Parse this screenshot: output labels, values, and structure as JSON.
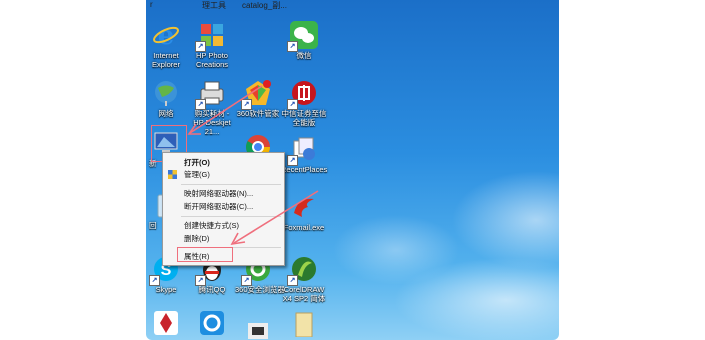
{
  "desktop": {
    "top_labels": [
      "r",
      "理工具",
      "catalog_副..."
    ],
    "icons": [
      {
        "label": "Internet Explorer",
        "icon": "internet-explorer-icon"
      },
      {
        "label": "HP Photo Creations",
        "icon": "hp-photo-icon"
      },
      {
        "label": "微信",
        "icon": "wechat-icon"
      },
      {
        "label": "网络",
        "icon": "network-icon"
      },
      {
        "label": "购买耗材 - HP Deskjet 21...",
        "icon": "printer-icon"
      },
      {
        "label": "360软件管家",
        "icon": "360-software-icon"
      },
      {
        "label": "中信证券至信全能版",
        "icon": "citic-icon"
      },
      {
        "label": "RecentPlaces",
        "icon": "recent-places-icon"
      },
      {
        "label": "Foxmail.exe",
        "icon": "foxmail-icon"
      },
      {
        "label": "Skype",
        "icon": "skype-icon"
      },
      {
        "label": "腾讯QQ",
        "icon": "qq-icon"
      },
      {
        "label": "360安全浏览器",
        "icon": "360-browser-icon"
      },
      {
        "label": "CorelDRAW X4 SP2 简体",
        "icon": "coreldraw-icon"
      }
    ],
    "partial_labels": [
      "新",
      "回",
      "图"
    ]
  },
  "context_menu": {
    "items": [
      {
        "label": "打开(O)",
        "bold": true
      },
      {
        "label": "管理(G)",
        "icon": "shield-icon"
      },
      {
        "label": "映射网络驱动器(N)..."
      },
      {
        "label": "断开网络驱动器(C)..."
      },
      {
        "label": "创建快捷方式(S)"
      },
      {
        "label": "删除(D)"
      },
      {
        "label": "属性(R)"
      }
    ]
  },
  "colors": {
    "annotation": "#ef6f7d",
    "desktop": "#2b8ee0"
  }
}
